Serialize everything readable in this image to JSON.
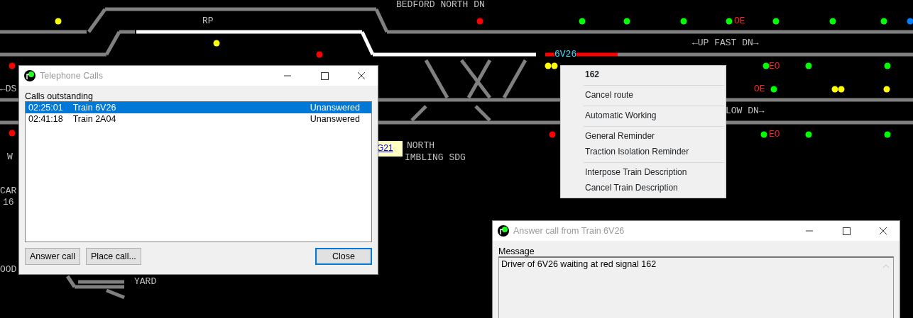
{
  "canvas": {
    "labels": [
      {
        "text": "BEDFORD NORTH DN",
        "kind": "label"
      },
      {
        "text": "RP",
        "kind": "label"
      },
      {
        "text": "←UP FAST DN→",
        "kind": "label"
      },
      {
        "text": "6V26",
        "kind": "train"
      },
      {
        "text": "OE",
        "kind": "marker"
      },
      {
        "text": "EO",
        "kind": "marker"
      },
      {
        "text": "OE",
        "kind": "marker"
      },
      {
        "text": "EO",
        "kind": "marker"
      },
      {
        "text": "LOW DN→",
        "kind": "label"
      },
      {
        "text": "←DS",
        "kind": "label"
      },
      {
        "text": "W",
        "kind": "label"
      },
      {
        "text": "CAR",
        "kind": "label"
      },
      {
        "text": "16",
        "kind": "label"
      },
      {
        "text": "OOD",
        "kind": "label"
      },
      {
        "text": "YARD",
        "kind": "label"
      },
      {
        "text": "NORTH",
        "kind": "label"
      },
      {
        "text": "IMBLING SDG",
        "kind": "label"
      }
    ],
    "signals": [
      {
        "color": "#ffff00"
      },
      {
        "color": "#ffff00"
      },
      {
        "color": "#ff0000"
      },
      {
        "color": "#ff0000"
      },
      {
        "color": "#00ff00"
      },
      {
        "color": "#00ff00"
      },
      {
        "color": "#00ff00"
      },
      {
        "color": "#00ff00"
      },
      {
        "color": "#00ff00"
      },
      {
        "color": "#00ff00"
      },
      {
        "color": "#00ff00"
      },
      {
        "color": "#0080ff"
      },
      {
        "color": "#ffff00"
      },
      {
        "color": "#ffff00"
      },
      {
        "color": "#00ff00"
      },
      {
        "color": "#00ff00"
      },
      {
        "color": "#00ff00"
      },
      {
        "color": "#00ff00"
      },
      {
        "color": "#ffff00"
      },
      {
        "color": "#ffff00"
      },
      {
        "color": "#ffff00"
      },
      {
        "color": "#ff0000"
      },
      {
        "color": "#ff0000"
      },
      {
        "color": "#00ff00"
      },
      {
        "color": "#00ff00"
      },
      {
        "color": "#00ff00"
      },
      {
        "color": "#ff0000"
      }
    ],
    "tooltip": {
      "text": "G21"
    }
  },
  "telephone_dialog": {
    "title": "Telephone Calls",
    "list_label": "Calls outstanding",
    "calls": [
      {
        "time": "02:25:01",
        "train": "Train 6V26",
        "status": "Unanswered",
        "selected": true
      },
      {
        "time": "02:41:18",
        "train": "Train 2A04",
        "status": "Unanswered",
        "selected": false
      }
    ],
    "buttons": [
      "Answer call",
      "Place call...",
      "Close"
    ]
  },
  "context_menu": {
    "header": "162",
    "groups": [
      [
        "Cancel route"
      ],
      [
        "Automatic Working"
      ],
      [
        "General Reminder",
        "Traction Isolation Reminder"
      ],
      [
        "Interpose Train Description",
        "Cancel Train Description"
      ]
    ]
  },
  "answer_dialog": {
    "title": "Answer call from Train 6V26",
    "message_label": "Message",
    "message": "Driver of 6V26 waiting at red signal 162"
  }
}
